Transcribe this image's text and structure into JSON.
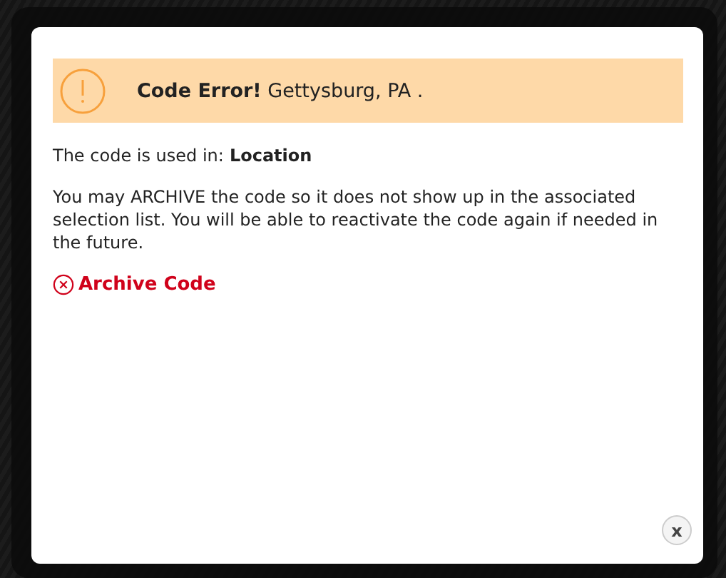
{
  "alert": {
    "title": "Code Error!",
    "message": "Gettysburg, PA ."
  },
  "usage": {
    "label": "The code is used in:",
    "value": "Location"
  },
  "explanation": "You may ARCHIVE the code so it does not show up in the associated selection list. You will be able to reactivate the code again if needed in the future.",
  "archive_link": "Archive Code",
  "close_button": "x"
}
